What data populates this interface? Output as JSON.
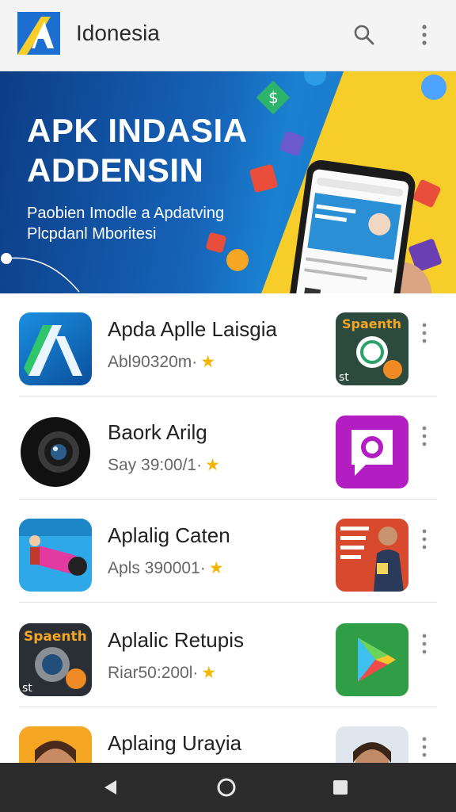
{
  "appbar": {
    "title": "Idonesia",
    "search_icon": "search-icon",
    "more_icon": "more-vert-icon"
  },
  "banner": {
    "title_line1": "APK INDASIA",
    "title_line2": "ADDENSIN",
    "subtitle_line1": "Paobien Imodle a Apdatving",
    "subtitle_line2": "Plcpdanl Mboritesi"
  },
  "apps": [
    {
      "name": "Apda Aplle Laisgia",
      "meta": "Abl90320m·",
      "icon": "stylized-a-app-icon",
      "thumb": "whatsapp-like-thumbnail"
    },
    {
      "name": "Baork Arilg",
      "meta": "Say 39:00/1·",
      "icon": "camera-lens-app-icon",
      "thumb": "chat-bubble-thumbnail"
    },
    {
      "name": "Aplalig Caten",
      "meta": "Apls 390001·",
      "icon": "video-app-icon",
      "thumb": "promo-person-thumbnail"
    },
    {
      "name": "Aplalic Retupis",
      "meta": "Riar50:200l·",
      "icon": "cartoon-camera-app-icon",
      "thumb": "play-store-thumbnail"
    },
    {
      "name": "Aplaing Urayia",
      "meta": "",
      "icon": "portrait-app-icon",
      "thumb": "portrait-thumbnail"
    }
  ],
  "star_glyph": "★",
  "colors": {
    "accent_blue": "#1663b8",
    "banner_yellow": "#f6cd29",
    "star": "#f2b705",
    "navbar": "#2c2c2c"
  }
}
